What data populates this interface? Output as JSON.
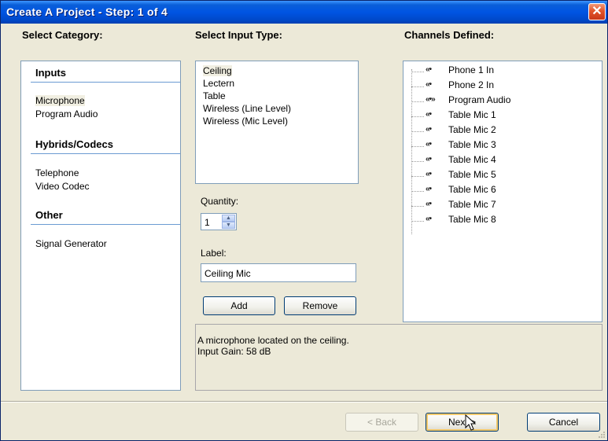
{
  "window": {
    "title": "Create A Project - Step: 1 of 4"
  },
  "category": {
    "header": "Select Category:",
    "groups": [
      {
        "title": "Inputs",
        "items": [
          "Microphone",
          "Program Audio"
        ]
      },
      {
        "title": "Hybrids/Codecs",
        "items": [
          "Telephone",
          "Video Codec"
        ]
      },
      {
        "title": "Other",
        "items": [
          "Signal Generator"
        ]
      }
    ],
    "selected": "Microphone"
  },
  "input_type": {
    "header": "Select Input Type:",
    "items": [
      "Ceiling",
      "Lectern",
      "Table",
      "Wireless (Line Level)",
      "Wireless (Mic Level)"
    ],
    "selected": "Ceiling"
  },
  "quantity": {
    "label": "Quantity:",
    "value": "1"
  },
  "label_field": {
    "label": "Label:",
    "value": "Ceiling Mic"
  },
  "buttons": {
    "add": "Add",
    "remove": "Remove",
    "back": "< Back",
    "next": "Next >",
    "cancel": "Cancel"
  },
  "description": {
    "line1": "A microphone located on the ceiling.",
    "line2": "Input Gain: 58 dB"
  },
  "channels": {
    "header": "Channels Defined:",
    "items": [
      {
        "icon": "«•",
        "label": "Phone 1 In"
      },
      {
        "icon": "«•",
        "label": "Phone 2 In"
      },
      {
        "icon": "«•»",
        "label": "Program Audio"
      },
      {
        "icon": "«•",
        "label": "Table Mic 1"
      },
      {
        "icon": "«•",
        "label": "Table Mic 2"
      },
      {
        "icon": "«•",
        "label": "Table Mic 3"
      },
      {
        "icon": "«•",
        "label": "Table Mic 4"
      },
      {
        "icon": "«•",
        "label": "Table Mic 5"
      },
      {
        "icon": "«•",
        "label": "Table Mic 6"
      },
      {
        "icon": "«•",
        "label": "Table Mic 7"
      },
      {
        "icon": "«•",
        "label": "Table Mic 8"
      }
    ]
  },
  "icons": {
    "close": "close-icon",
    "spin_up": "spin-up-icon",
    "spin_down": "spin-down-icon",
    "channel": "input-channel-icon",
    "stereo": "stereo-channel-icon"
  }
}
